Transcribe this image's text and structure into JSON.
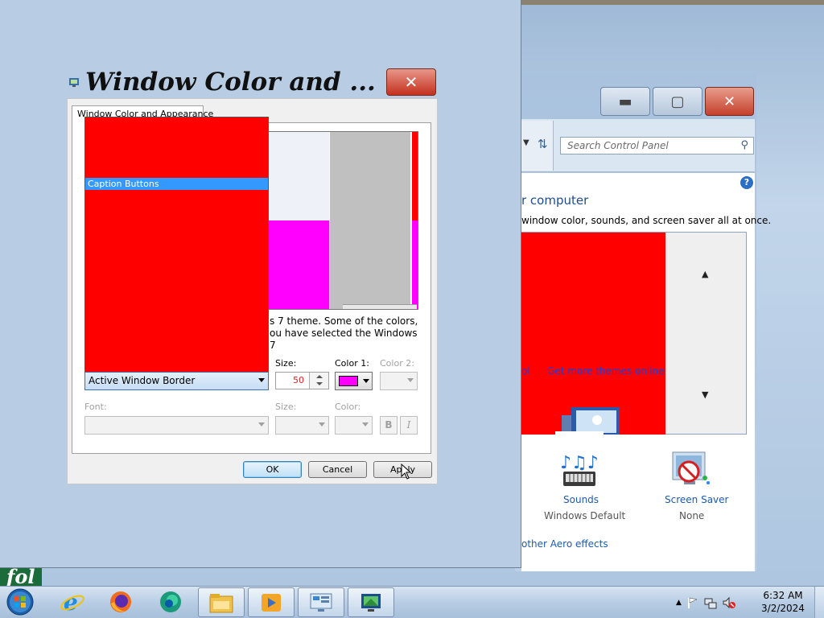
{
  "dialog": {
    "title": "Window Color and ...",
    "tab_label": "Window Color and Appearance",
    "list_selected": "Caption Buttons",
    "item_select_value": "Active Window Border",
    "info_text": "s 7 theme.  Some of the colors, ou have selected the Windows 7",
    "size_label": "Size:",
    "size_value": "50",
    "color1_label": "Color 1:",
    "color1_value": "#ff00ff",
    "color2_label": "Color 2:",
    "font_label": "Font:",
    "font_size_label": "Size:",
    "font_color_label": "Color:",
    "bold_label": "B",
    "italic_label": "I",
    "ok_label": "OK",
    "cancel_label": "Cancel",
    "apply_label": "Apply",
    "close_glyph": "✕"
  },
  "control_panel": {
    "search_placeholder": "Search Control Panel",
    "heading": "r computer",
    "subtext": "window color, sounds, and screen saver all at once.",
    "link_left": "ol",
    "link_more_themes": "Get more themes online",
    "sounds_label": "Sounds",
    "sounds_value": "Windows Default",
    "saver_label": "Screen Saver",
    "saver_value": "None",
    "aero_link": "other Aero effects",
    "help_glyph": "?"
  },
  "desktop": {
    "folder_text": "fol"
  },
  "taskbar": {
    "pinned": [
      "start-orb",
      "internet-explorer-icon",
      "firefox-icon",
      "edge-icon"
    ],
    "open": [
      "file-explorer-icon",
      "media-player-icon",
      "control-panel-icon",
      "personalization-icon"
    ],
    "clock_time": "6:32 AM",
    "clock_date": "3/2/2024"
  },
  "colors": {
    "accent_red": "#ff0000",
    "magenta": "#ff00ff",
    "selection_blue": "#3399ff",
    "link_blue": "#1e5aa8"
  }
}
